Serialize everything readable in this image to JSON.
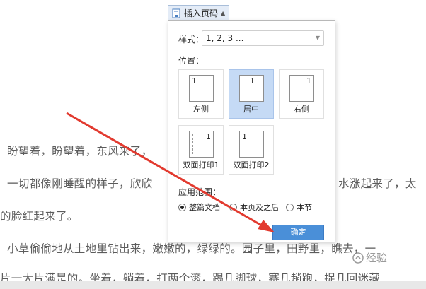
{
  "document": {
    "lines": [
      "盼望着，盼望着，东风来了，",
      "一切都像刚睡醒的样子，欣欣",
      "水涨起来了，太",
      "的脸红起来了。",
      "小草偷偷地从土地里钻出来，嫩嫩的，绿绿的。园子里，田野里，瞧去，一",
      "片一大片满是的。坐着，躺着，打两个滚，踢几脚球，赛几趟跑，捉几回迷藏"
    ]
  },
  "toolbar": {
    "insert_page_number_label": "插入页码"
  },
  "popup": {
    "style_label": "样式：",
    "style_value": "1, 2, 3 ...",
    "position_label": "位置：",
    "positions": [
      {
        "label": "左侧",
        "num": "1",
        "selected": false
      },
      {
        "label": "居中",
        "num": "1",
        "selected": true
      },
      {
        "label": "右侧",
        "num": "1",
        "selected": false
      },
      {
        "label": "双面打印1",
        "num": "1",
        "selected": false
      },
      {
        "label": "双面打印2",
        "num": "1",
        "selected": false
      }
    ],
    "scope_label": "应用范围：",
    "scope_options": [
      {
        "label": "整篇文档",
        "checked": true
      },
      {
        "label": "本页及之后",
        "checked": false
      },
      {
        "label": "本节",
        "checked": false
      }
    ],
    "ok_label": "确定"
  },
  "watermark": {
    "text": "经验"
  },
  "colors": {
    "accent": "#4a8fd8",
    "selected_tile": "#c5daf5",
    "arrow": "#e23a2f"
  }
}
